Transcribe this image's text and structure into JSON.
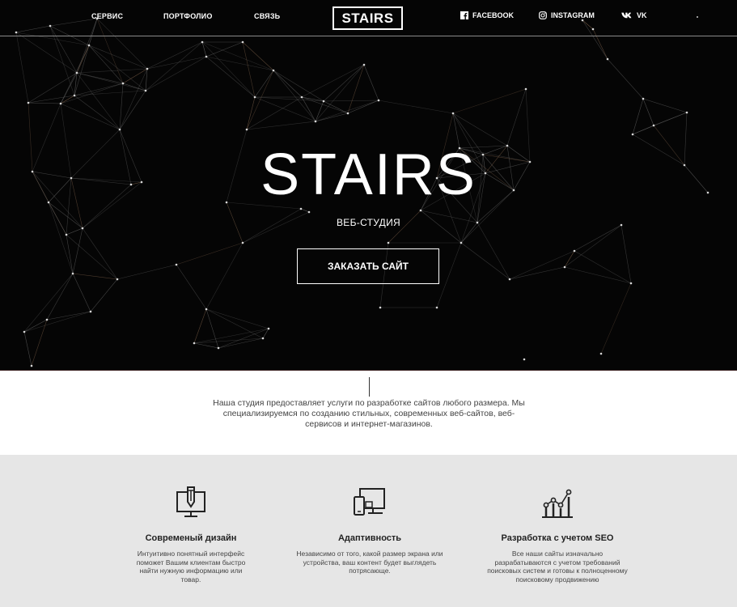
{
  "nav": {
    "links": [
      "СЕРВИС",
      "ПОРТФОЛИО",
      "СВЯЗЬ"
    ],
    "logo": "STAIRS",
    "social": [
      {
        "label": "FACEBOOK",
        "icon": "facebook-icon"
      },
      {
        "label": "INSTAGRAM",
        "icon": "instagram-icon"
      },
      {
        "label": "VK",
        "icon": "vk-icon"
      }
    ]
  },
  "hero": {
    "title": "STAIRS",
    "subtitle": "ВЕБ-СТУДИЯ",
    "cta_label": "ЗАКАЗАТЬ САЙТ"
  },
  "about": {
    "text": "Наша студия предоставляет услуги по разработке сайтов любого размера. Мы специализируемся по созданию стильных, современных веб-сайтов, веб-сервисов и интернет-магазинов."
  },
  "features": [
    {
      "icon": "design-icon",
      "title": "Современый дизайн",
      "text": "Интуитивно понятный интерфейс поможет Вашим клиентам быстро найти нужную информацию или товар."
    },
    {
      "icon": "devices-icon",
      "title": "Адаптивность",
      "text": "Независимо от того, какой размер экрана или устройства, ваш контент будет выглядеть потрясающе."
    },
    {
      "icon": "seo-chart-icon",
      "title": "Разработка с учетом SEO",
      "text": "Все наши сайты изначально разрабатываются с учетом требований поисковых систем и готовы к полноценному поисковому продвижению"
    }
  ],
  "colors": {
    "hero_bg": "#050505",
    "features_bg": "#e6e6e6",
    "text_dark": "#222222",
    "text_body": "#444444"
  }
}
